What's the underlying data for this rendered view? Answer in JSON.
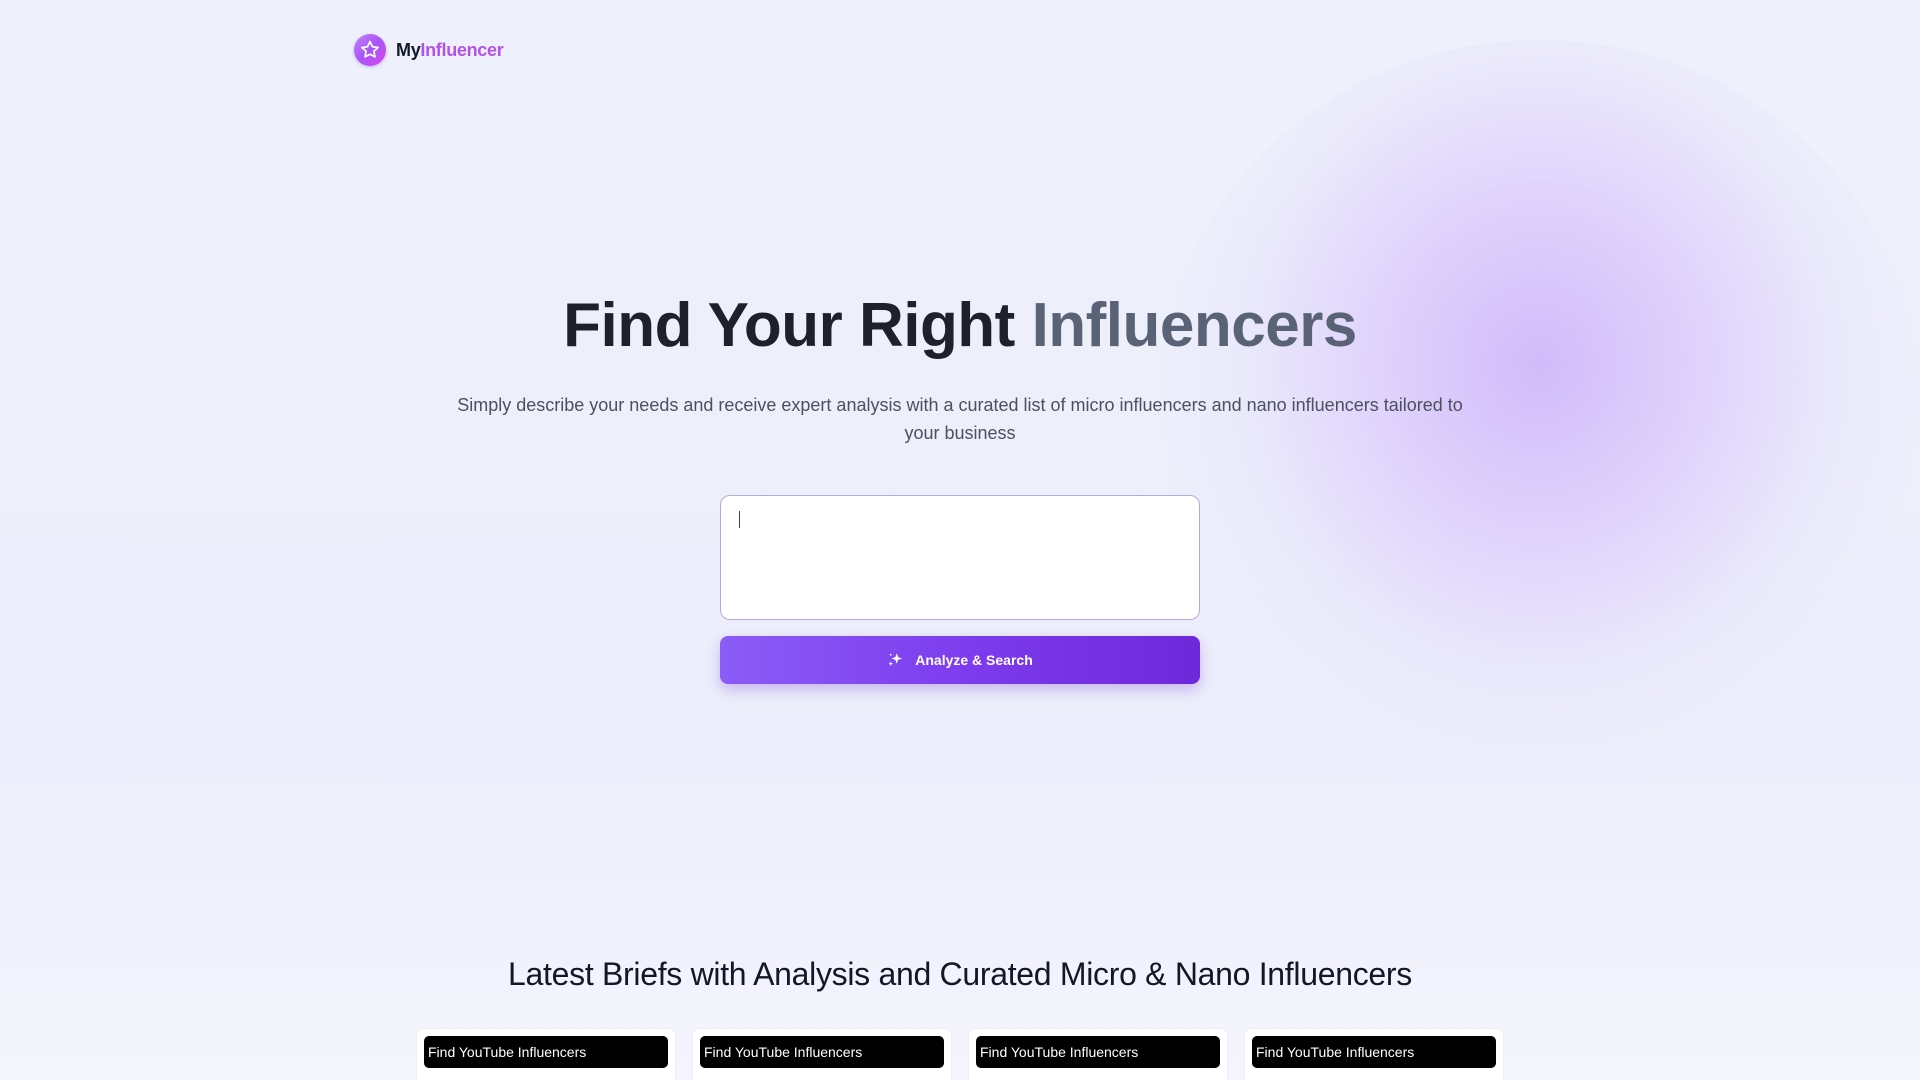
{
  "brand": {
    "prefix": "My",
    "suffix": "Influencer",
    "logo_icon": "star-icon",
    "accent_color": "#b452e6"
  },
  "hero": {
    "title_main": "Find Your Right ",
    "title_accent": "Influencers",
    "subtitle": "Simply describe your needs and receive expert analysis with a curated list of micro influencers and nano influencers tailored to your business"
  },
  "search": {
    "value": "",
    "button_label": "Analyze & Search",
    "button_icon": "sparkles-icon",
    "button_color": "#7c3aed"
  },
  "briefs": {
    "heading": "Latest Briefs with Analysis and Curated Micro & Nano Influencers",
    "cards": [
      {
        "tag": "Find YouTube Influencers"
      },
      {
        "tag": "Find YouTube Influencers"
      },
      {
        "tag": "Find YouTube Influencers"
      },
      {
        "tag": "Find YouTube Influencers"
      }
    ]
  }
}
